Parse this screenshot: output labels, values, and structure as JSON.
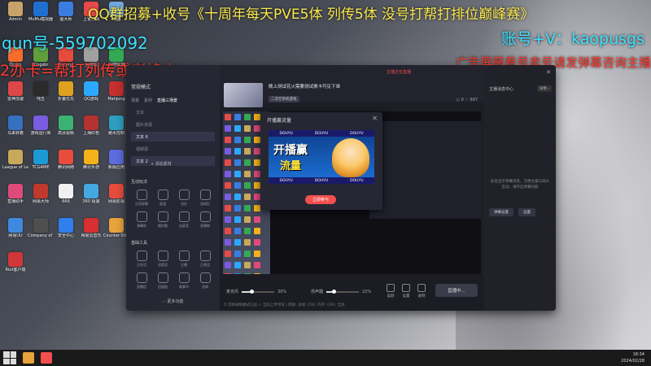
{
  "overlays": {
    "top_banner": "QQ群招募+收号《十周年每天PVE5体 列传5体 没号打帮打排位巅峰赛》",
    "qq_number": "qun号-559702092",
    "account": "账号+V：kaopusgs",
    "left_line2": "2办卡=帮打列传或者烽火",
    "right_line2": "广告屏蔽看号卖号请发弹幕咨询主播"
  },
  "desktop": {
    "icons": [
      {
        "label": "Admin",
        "color": "#c7a36a"
      },
      {
        "label": "MuMu模拟器",
        "color": "#1f6fd1"
      },
      {
        "label": "图大师",
        "color": "#3a7de0"
      },
      {
        "label": "上官方网",
        "color": "#e84a4a"
      },
      {
        "label": "电脑",
        "color": "#6fa8dc"
      },
      {
        "label": "Origin",
        "color": "#f56c2d"
      },
      {
        "label": "Kingsbr",
        "color": "#5e9e3c"
      },
      {
        "label": "Garena",
        "color": "#e54c3c"
      },
      {
        "label": "回收站",
        "color": "#a0a0a0"
      },
      {
        "label": "网吧快速",
        "color": "#34a853"
      },
      {
        "label": "雷神加速",
        "color": "#dd4747"
      },
      {
        "label": "忳五",
        "color": "#2b2b2b"
      },
      {
        "label": "折叠优先",
        "color": "#e0a020"
      },
      {
        "label": "QQ游戏",
        "color": "#2da8ff"
      },
      {
        "label": "Mahjong",
        "color": "#c53030"
      },
      {
        "label": "马来转着",
        "color": "#3670c0"
      },
      {
        "label": "游戏运行库",
        "color": "#7a5ce0"
      },
      {
        "label": "高清视频",
        "color": "#3bb273"
      },
      {
        "label": "上海红色",
        "color": "#b33232"
      },
      {
        "label": "跑水控制",
        "color": "#2e9ebf"
      },
      {
        "label": "League of Legends",
        "color": "#c8a95b"
      },
      {
        "label": "TCGAME",
        "color": "#1b9ad6"
      },
      {
        "label": "腾讯网络",
        "color": "#e74c3c"
      },
      {
        "label": "腾讯手游",
        "color": "#f3b21a"
      },
      {
        "label": "新版应用",
        "color": "#5d6cde"
      },
      {
        "label": "直播助手",
        "color": "#e04a7b"
      },
      {
        "label": "网易大师",
        "color": "#c0392b"
      },
      {
        "label": "666",
        "color": "#f0f0f0"
      },
      {
        "label": "360 极速",
        "color": "#44a7e0"
      },
      {
        "label": "网易影视",
        "color": "#e74c3c"
      },
      {
        "label": "网易UU",
        "color": "#3f8ae0"
      },
      {
        "label": "Company of Heroes 2",
        "color": "#4f4f4f"
      },
      {
        "label": "安全中心",
        "color": "#2f80ed"
      },
      {
        "label": "网易云音乐",
        "color": "#d83030"
      },
      {
        "label": "Counter-Strike",
        "color": "#e8a33c"
      },
      {
        "label": "Riot客户端",
        "color": "#d13639"
      }
    ]
  },
  "app": {
    "scene_mode": "常规模式",
    "scene_tabs": [
      "场景",
      "素材",
      "直播三场景"
    ],
    "sources": [
      "文本",
      "图片资源",
      "文本 6",
      "视频源",
      "文本 2"
    ],
    "add_source": "+ 添加素材",
    "section_interactive": "互动玩法",
    "interactive_tools": [
      "点亮屏幕",
      "星道",
      "也在",
      "游戏形",
      "弹幕地",
      "跳时看",
      "连麦奖",
      "直播制"
    ],
    "section_basic": "基础工具",
    "basic_tools": [
      "正在设",
      "封面设",
      "主播",
      "正视设",
      "直播回",
      "回放链",
      "故事书",
      "咨询"
    ],
    "more_features": "··· 更多功能",
    "stream_title": "晚上测试花火需要测试换卡可见下准",
    "stream_tag": "二次元单机游戏",
    "top_status": "主播正在直播",
    "counts": "○ 0    ♡ 697",
    "mic_label": "麦克风",
    "mic_value": 30,
    "mic_pct": "30%",
    "speaker_label": "扬声器",
    "speaker_value": 22,
    "speaker_pct": "22%",
    "mini_buttons": [
      "美颜",
      "设置",
      "录制"
    ],
    "live_button": "直播中...",
    "status_bar": "⏱ 流畅录制模式已设  ⚠ 当前上传带宽  |  网速:  丢帧:  CPU:  内存:  GPU:  全屏",
    "right_panel_title": "主播消息中心",
    "right_panel_detail": "详情 ›",
    "right_panel_msg": "此处显示弹幕消息，方便主播与观众互动，请开启弹幕功能",
    "right_panel_btn1": "弹幕设置",
    "right_panel_btn2": "设置",
    "close_glyph": "✕"
  },
  "dialog": {
    "title": "开播赢流量",
    "close": "✕",
    "banner_strip": [
      "DOUYU",
      "DOUYU",
      "DOUYU"
    ],
    "banner_word1": "开播赢",
    "banner_word2": "流量",
    "button": "立即参与"
  },
  "taskbar": {
    "time": "18:34",
    "date": "2024/02/28"
  },
  "colors": {
    "accent_red": "#f24f4f",
    "overlay_yellow": "#fbe94f",
    "overlay_cyan": "#3de0ff",
    "overlay_red": "#ff3b30"
  }
}
